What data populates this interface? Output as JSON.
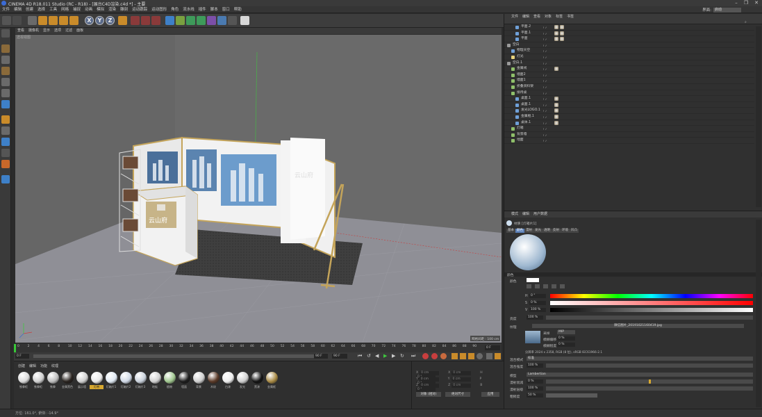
{
  "window": {
    "title": "CINEMA 4D R18.011 Studio (RC - R18) - [展台C4D渲染.c4d *] - 主要",
    "controls": [
      "–",
      "❐",
      "✕"
    ]
  },
  "menubar": {
    "items": [
      "文件",
      "编辑",
      "创建",
      "选择",
      "工具",
      "网格",
      "捕捉",
      "动画",
      "模拟",
      "渲染",
      "雕刻",
      "运动跟踪",
      "运动图形",
      "角色",
      "流水线",
      "插件",
      "脚本",
      "窗口",
      "帮助"
    ],
    "layout_label": "界面:",
    "layout_value": "启动"
  },
  "toolbar": {
    "x_label": "X",
    "y_label": "Y",
    "z_label": "Z"
  },
  "viewport": {
    "menu": [
      "查看",
      "摄像机",
      "显示",
      "选项",
      "过滤",
      "面板"
    ],
    "view_name": "透视视图",
    "grid_spacing": "网格间距 : 100 cm",
    "booth_sign": "云山府"
  },
  "timeline": {
    "ticks": [
      "0",
      "2",
      "4",
      "6",
      "8",
      "10",
      "12",
      "14",
      "16",
      "18",
      "20",
      "22",
      "24",
      "26",
      "28",
      "30",
      "32",
      "34",
      "36",
      "38",
      "40",
      "42",
      "44",
      "46",
      "48",
      "50",
      "52",
      "54",
      "56",
      "58",
      "60",
      "62",
      "64",
      "66",
      "68",
      "70",
      "72",
      "74",
      "76",
      "78",
      "80",
      "82",
      "84",
      "86",
      "88",
      "90"
    ],
    "end_frame": "0 F",
    "current_start": "0 F",
    "current_mid": "90 F",
    "current_end": "90 F"
  },
  "materials": {
    "menu": [
      "创建",
      "编辑",
      "功能",
      "纹理"
    ],
    "items": [
      {
        "label": "铁拳柜",
        "color": "#d9d9d9"
      },
      {
        "label": "铁拳柜",
        "color": "#cfcfcf"
      },
      {
        "label": "铁拳",
        "color": "#bdbdbd"
      },
      {
        "label": "金属黑色",
        "color": "#2a2420"
      },
      {
        "label": "展示墙",
        "color": "#cfcfcf"
      },
      {
        "label": "灯带",
        "color": "#e8e8e8"
      },
      {
        "label": "灯箱片1",
        "color": "#dfe8f2"
      },
      {
        "label": "灯箱片2",
        "color": "#cfd8e5"
      },
      {
        "label": "灯箱片3",
        "color": "#c8d0da"
      },
      {
        "label": "地板",
        "color": "#d0d0d0"
      },
      {
        "label": "植物",
        "color": "#9fc58e"
      },
      {
        "label": "墙面",
        "color": "#1e1e1e"
      },
      {
        "label": "背景",
        "color": "#cfcfcf"
      },
      {
        "label": "木纹",
        "color": "#5a3a28"
      },
      {
        "label": "白漆",
        "color": "#ededed"
      },
      {
        "label": "发光",
        "color": "#cfcfcf"
      },
      {
        "label": "黑漆",
        "color": "#151515"
      },
      {
        "label": "金属框",
        "color": "#a88a45"
      }
    ]
  },
  "coordinates": {
    "rows": [
      {
        "a": "X",
        "av": "0 cm",
        "b": "X",
        "bv": "0 cm",
        "c": "H",
        "cv": "0 °"
      },
      {
        "a": "Y",
        "av": "0 cm",
        "b": "Y",
        "bv": "0 cm",
        "c": "P",
        "cv": "0 °"
      },
      {
        "a": "Z",
        "av": "0 cm",
        "b": "Z",
        "bv": "0 cm",
        "c": "B",
        "cv": "0 °"
      }
    ],
    "mode": "对象 (相对)",
    "size_mode": "绝对尺寸",
    "apply": "应用"
  },
  "statusbar": {
    "text": "方位: 161.0°, 俯仰: -14.9°"
  },
  "objects": {
    "menu": [
      "文件",
      "编辑",
      "查看",
      "对象",
      "标签",
      "书签"
    ],
    "rows": [
      {
        "name": "平面.2",
        "indent": 2,
        "color": "#6fa0d8",
        "tags": 2
      },
      {
        "name": "平面.1",
        "indent": 2,
        "color": "#6fa0d8",
        "tags": 2
      },
      {
        "name": "平面",
        "indent": 2,
        "color": "#6fa0d8",
        "tags": 2
      },
      {
        "name": "空白",
        "indent": 0,
        "color": "#9a9a9a",
        "tags": 0
      },
      {
        "name": "物理天空",
        "indent": 1,
        "color": "#6fa0d8",
        "tags": 0
      },
      {
        "name": "灯光",
        "indent": 1,
        "color": "#e8d27a",
        "tags": 0
      },
      {
        "name": "空白.1",
        "indent": 0,
        "color": "#9a9a9a",
        "tags": 0
      },
      {
        "name": "金属线",
        "indent": 1,
        "color": "#8fbf6a",
        "tags": 1
      },
      {
        "name": "墙面2",
        "indent": 1,
        "color": "#8fbf6a",
        "tags": 0
      },
      {
        "name": "墙面1",
        "indent": 1,
        "color": "#8fbf6a",
        "tags": 0
      },
      {
        "name": "折叠资料架",
        "indent": 1,
        "color": "#8fbf6a",
        "tags": 0
      },
      {
        "name": "接待桌",
        "indent": 1,
        "color": "#8fbf6a",
        "tags": 0
      },
      {
        "name": "桌面.1",
        "indent": 2,
        "color": "#6fa0d8",
        "tags": 1
      },
      {
        "name": "桌面.1",
        "indent": 2,
        "color": "#6fa0d8",
        "tags": 1
      },
      {
        "name": "发光LOGO.1",
        "indent": 2,
        "color": "#6fa0d8",
        "tags": 1
      },
      {
        "name": "金属框.1",
        "indent": 2,
        "color": "#6fa0d8",
        "tags": 1
      },
      {
        "name": "桌体.1",
        "indent": 2,
        "color": "#6fa0d8",
        "tags": 1
      },
      {
        "name": "灯箱",
        "indent": 1,
        "color": "#8fbf6a",
        "tags": 0
      },
      {
        "name": "背景墙",
        "indent": 1,
        "color": "#8fbf6a",
        "tags": 0
      },
      {
        "name": "地面",
        "indent": 1,
        "color": "#8fbf6a",
        "tags": 0
      }
    ]
  },
  "attributes": {
    "menu": [
      "模式",
      "编辑",
      "用户数据"
    ],
    "material_title": "材质 [灯箱片1]",
    "tabs": [
      "基本",
      "颜色",
      "漫射",
      "发光",
      "透明",
      "反射",
      "环境",
      "凹凸",
      "法线",
      "Alpha",
      "辉光",
      "置换",
      "编辑",
      "光照",
      "指定"
    ],
    "section_color": "颜色",
    "color_label": "颜色",
    "h_label": "H",
    "h_value": "0 °",
    "s_label": "S",
    "s_value": "0 %",
    "v_label": "V",
    "v_value": "100 %",
    "brightness_label": "亮度",
    "brightness_value": "100 %",
    "texture_label": "纹理",
    "texture_file": "微信图片_20191021160419.jpg",
    "sampling_label": "采样",
    "sampling_value": "MIP",
    "blur_offset_label": "模糊偏移",
    "blur_offset_value": "0 %",
    "blur_scale_label": "模糊程度",
    "blur_scale_value": "0 %",
    "resolution": "分辨率 2024 x 2358, RGB (8 位), sRGB IEC61966-2.1",
    "mix_mode_label": "混合模式",
    "mix_mode_value": "标准",
    "mix_strength_label": "混合强度",
    "mix_strength_value": "100 %",
    "model_label": "模型",
    "model_value": "Lambertian",
    "diffuse_falloff_label": "漫射衰减",
    "diffuse_falloff_value": "0 %",
    "diffuse_level_label": "漫射层级",
    "diffuse_level_value": "100 %",
    "roughness_label": "粗糙度",
    "roughness_value": "50 %"
  },
  "colors": {
    "accent": "#d7a830",
    "selected_tab": "#5a7fb8",
    "background": "#2b2b2b"
  }
}
